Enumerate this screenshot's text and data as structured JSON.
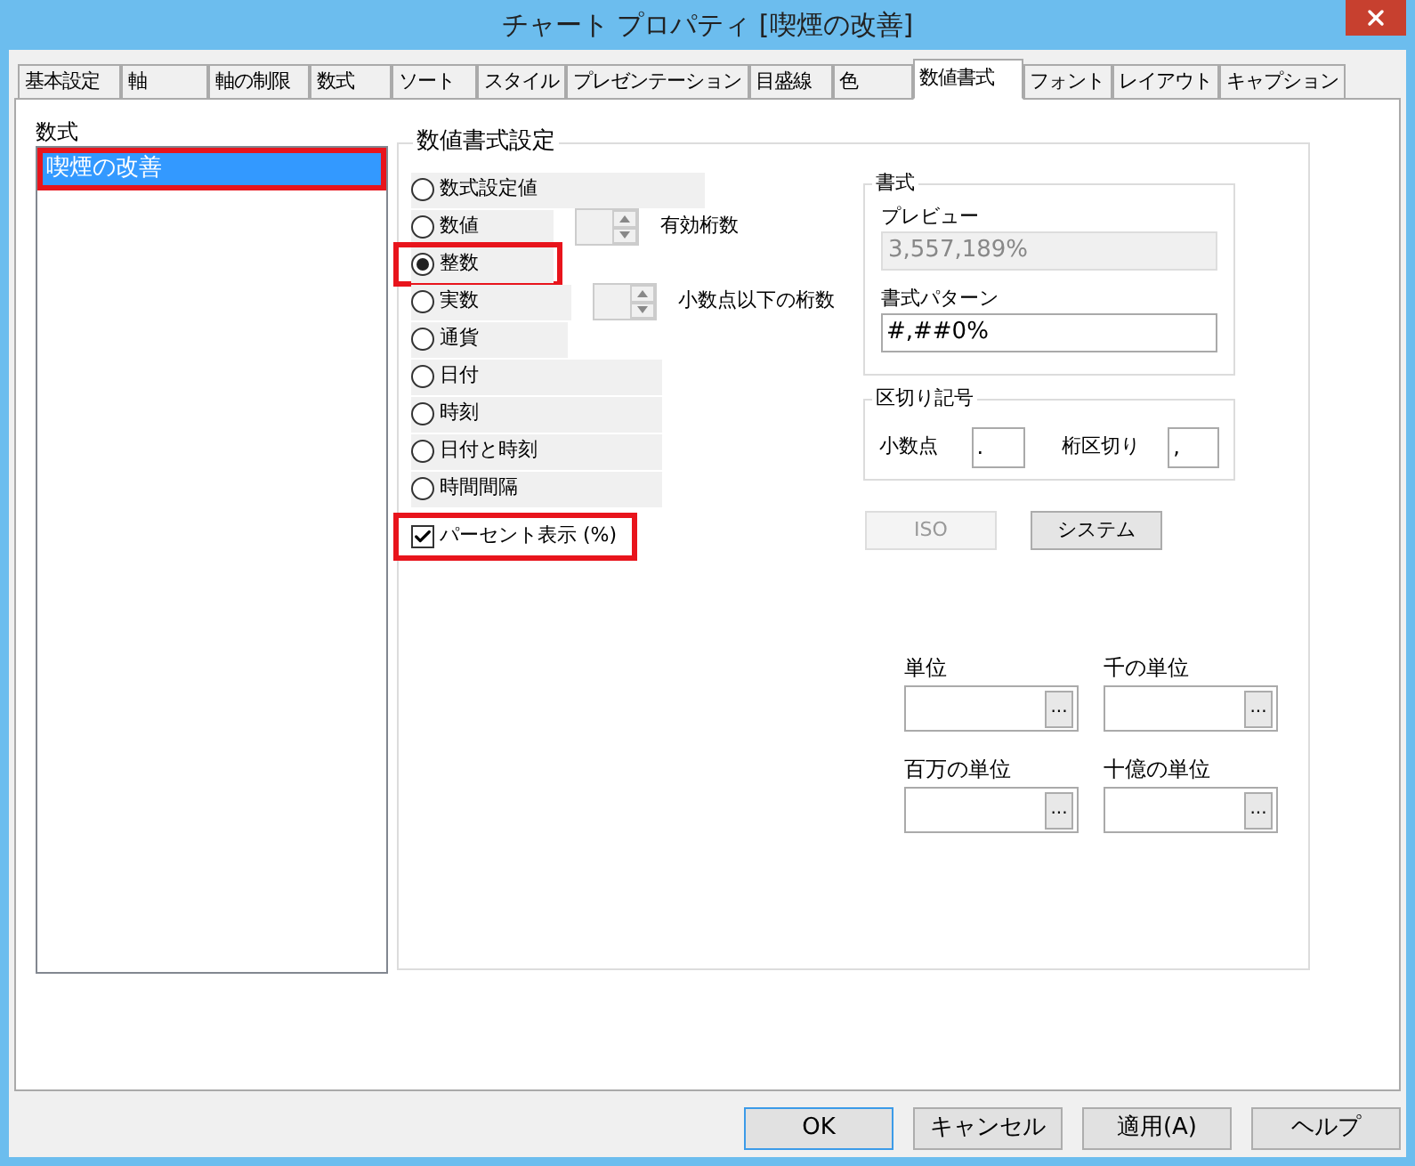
{
  "window": {
    "title": "チャート プロパティ [喫煙の改善]"
  },
  "tabs": [
    {
      "label": "基本設定",
      "selected": false
    },
    {
      "label": "軸",
      "selected": false
    },
    {
      "label": "軸の制限",
      "selected": false
    },
    {
      "label": "数式",
      "selected": false
    },
    {
      "label": "ソート",
      "selected": false
    },
    {
      "label": "スタイル",
      "selected": false
    },
    {
      "label": "プレゼンテーション",
      "selected": false
    },
    {
      "label": "目盛線",
      "selected": false
    },
    {
      "label": "色",
      "selected": false
    },
    {
      "label": "数値書式",
      "selected": true
    },
    {
      "label": "フォント",
      "selected": false
    },
    {
      "label": "レイアウト",
      "selected": false
    },
    {
      "label": "キャプション",
      "selected": false
    }
  ],
  "formula_list": {
    "label": "数式",
    "items": [
      {
        "text": "喫煙の改善",
        "selected": true,
        "highlighted": true
      }
    ]
  },
  "number_format": {
    "title": "数値書式設定",
    "options": [
      {
        "label": "数式設定値",
        "selected": false,
        "highlighted": false
      },
      {
        "label": "数値",
        "selected": false,
        "highlighted": false,
        "spinner_label": "有効桁数"
      },
      {
        "label": "整数",
        "selected": true,
        "highlighted": true
      },
      {
        "label": "実数",
        "selected": false,
        "highlighted": false,
        "spinner_label": "小数点以下の桁数"
      },
      {
        "label": "通貨",
        "selected": false,
        "highlighted": false
      },
      {
        "label": "日付",
        "selected": false,
        "highlighted": false
      },
      {
        "label": "時刻",
        "selected": false,
        "highlighted": false
      },
      {
        "label": "日付と時刻",
        "selected": false,
        "highlighted": false
      },
      {
        "label": "時間間隔",
        "selected": false,
        "highlighted": false
      }
    ],
    "percent": {
      "label": "パーセント表示 (%)",
      "checked": true,
      "highlighted": true
    }
  },
  "format": {
    "title": "書式",
    "preview_label": "プレビュー",
    "preview": "3,557,189%",
    "pattern_label": "書式パターン",
    "pattern": "#,##0%"
  },
  "separators": {
    "title": "区切り記号",
    "decimal_label": "小数点",
    "decimal": ".",
    "thousands_label": "桁区切り",
    "thousands": ","
  },
  "preset_buttons": [
    {
      "label": "ISO",
      "disabled": true
    },
    {
      "label": "システム",
      "disabled": false
    }
  ],
  "units": [
    {
      "label": "単位",
      "button": "..."
    },
    {
      "label": "千の単位",
      "button": "..."
    },
    {
      "label": "百万の単位",
      "button": "..."
    },
    {
      "label": "十億の単位",
      "button": "..."
    }
  ],
  "buttons": [
    {
      "label": "OK",
      "default": true
    },
    {
      "label": "キャンセル",
      "default": false
    },
    {
      "label": "適用(A)",
      "default": false
    },
    {
      "label": "ヘルプ",
      "default": false
    }
  ]
}
